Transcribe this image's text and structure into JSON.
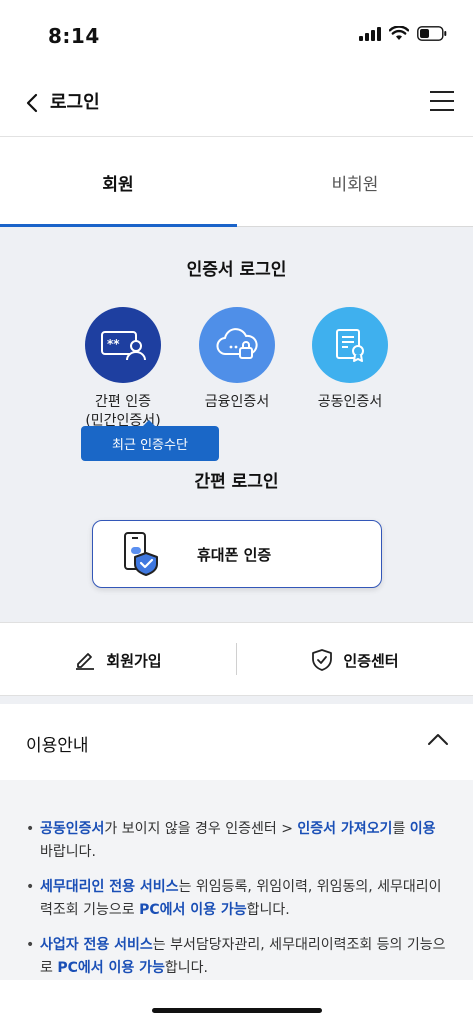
{
  "status_bar": {
    "time": "8:14"
  },
  "header": {
    "title": "로그인"
  },
  "tabs": [
    {
      "label": "회원",
      "active": true
    },
    {
      "label": "비회원",
      "active": false
    }
  ],
  "cert_login": {
    "title": "인증서 로그인",
    "items": [
      {
        "label_line1": "간편 인증",
        "label_line2": "(민간인증서)",
        "color": "#1e3fa0"
      },
      {
        "label_line1": "금융인증서",
        "label_line2": "",
        "color": "#4f8fe8"
      },
      {
        "label_line1": "공동인증서",
        "label_line2": "",
        "color": "#3fb0ee"
      }
    ],
    "recent_tooltip": "최근 인증수단"
  },
  "easy_login": {
    "title": "간편 로그인",
    "phone_button": "휴대폰 인증"
  },
  "links": {
    "signup": "회원가입",
    "cert_center": "인증센터"
  },
  "usage": {
    "title": "이용안내",
    "items": [
      {
        "parts": [
          {
            "text": "공동인증서",
            "hl": true
          },
          {
            "text": "가 보이지 않을 경우 인증센터 > ",
            "hl": false
          },
          {
            "text": "인증서 가져오기",
            "hl": true
          },
          {
            "text": "를 ",
            "hl": false
          },
          {
            "text": "이용",
            "hl": true
          },
          {
            "text": " 바랍니다.",
            "hl": false
          }
        ]
      },
      {
        "parts": [
          {
            "text": "세무대리인 전용 서비스",
            "hl": true
          },
          {
            "text": "는 위임등록, 위임이력, 위임동의, 세무대리이력조회 기능으로 ",
            "hl": false
          },
          {
            "text": "PC에서 이용 가능",
            "hl": true
          },
          {
            "text": "합니다.",
            "hl": false
          }
        ]
      },
      {
        "parts": [
          {
            "text": "사업자 전용 서비스",
            "hl": true
          },
          {
            "text": "는 부서담당자관리, 세무대리이력조회 등의 기능으로 ",
            "hl": false
          },
          {
            "text": "PC에서 이용 가능",
            "hl": true
          },
          {
            "text": "합니다.",
            "hl": false
          }
        ]
      }
    ]
  },
  "colors": {
    "accent": "#1a63c9",
    "panel_bg": "#eef0f4",
    "highlight_text": "#1a4fb6"
  }
}
